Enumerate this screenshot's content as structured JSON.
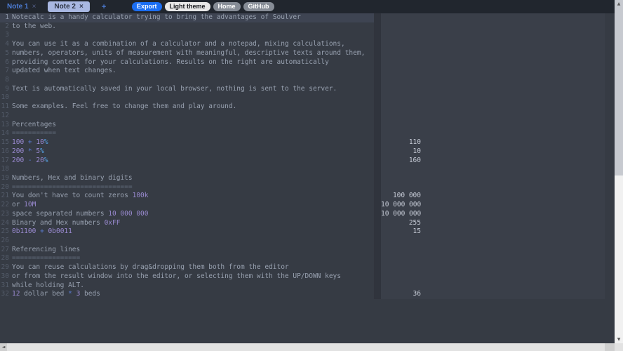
{
  "tabs": [
    {
      "label": "Note 1",
      "close": "×",
      "active": false
    },
    {
      "label": "Note 2",
      "close": "×",
      "active": true
    }
  ],
  "new_tab": "+",
  "toolbar": {
    "export": "Export",
    "light_theme": "Light theme",
    "home": "Home",
    "github": "GitHub"
  },
  "scrollbars": {
    "up": "▲",
    "down": "▼",
    "left": "◄"
  },
  "colors": {
    "topbar_bg": "#21262e",
    "editor_bg": "#363b44",
    "results_bg": "#3a3f49",
    "highlight_row_bg": "#3e4452",
    "accent_blue": "#1b6ef3",
    "tab_active_bg": "#a9b8e2",
    "text": "#98a1b0",
    "number": "#9b8bd2",
    "operator": "#5a7bd0",
    "percent": "#55a1e3",
    "result_text": "#c9ced9"
  },
  "editor": {
    "lines": [
      {
        "num": 1,
        "segments": [
          {
            "type": "t",
            "text": "Notecalc is a handy calculator trying to bring the advantages of Soulver"
          }
        ],
        "result": ""
      },
      {
        "num": 2,
        "segments": [
          {
            "type": "t",
            "text": "to the web."
          }
        ],
        "result": ""
      },
      {
        "num": 3,
        "segments": [],
        "result": ""
      },
      {
        "num": 4,
        "segments": [
          {
            "type": "t",
            "text": "You can use it as a combination of a calculator and a notepad, mixing calculations,"
          }
        ],
        "result": ""
      },
      {
        "num": 5,
        "segments": [
          {
            "type": "t",
            "text": "numbers, operators, units of measurement with meaningful, descriptive texts around them,"
          }
        ],
        "result": ""
      },
      {
        "num": 6,
        "segments": [
          {
            "type": "t",
            "text": "providing context for your calculations. Results on the right are automatically"
          }
        ],
        "result": ""
      },
      {
        "num": 7,
        "segments": [
          {
            "type": "t",
            "text": "updated when text changes."
          }
        ],
        "result": ""
      },
      {
        "num": 8,
        "segments": [],
        "result": ""
      },
      {
        "num": 9,
        "segments": [
          {
            "type": "t",
            "text": "Text is automatically saved in your local browser, nothing is sent to the server."
          }
        ],
        "result": ""
      },
      {
        "num": 10,
        "segments": [],
        "result": ""
      },
      {
        "num": 11,
        "segments": [
          {
            "type": "t",
            "text": "Some examples. Feel free to change them and play around."
          }
        ],
        "result": ""
      },
      {
        "num": 12,
        "segments": [],
        "result": ""
      },
      {
        "num": 13,
        "segments": [
          {
            "type": "t",
            "text": "Percentages"
          }
        ],
        "result": ""
      },
      {
        "num": 14,
        "segments": [
          {
            "type": "eq",
            "text": "==========="
          }
        ],
        "result": ""
      },
      {
        "num": 15,
        "segments": [
          {
            "type": "n",
            "text": "100"
          },
          {
            "type": "t",
            "text": " "
          },
          {
            "type": "o",
            "text": "+"
          },
          {
            "type": "t",
            "text": " "
          },
          {
            "type": "n",
            "text": "10"
          },
          {
            "type": "p",
            "text": "%"
          }
        ],
        "result": "110"
      },
      {
        "num": 16,
        "segments": [
          {
            "type": "n",
            "text": "200"
          },
          {
            "type": "t",
            "text": " "
          },
          {
            "type": "o",
            "text": "*"
          },
          {
            "type": "t",
            "text": " "
          },
          {
            "type": "n",
            "text": "5"
          },
          {
            "type": "p",
            "text": "%"
          }
        ],
        "result": "10"
      },
      {
        "num": 17,
        "segments": [
          {
            "type": "n",
            "text": "200"
          },
          {
            "type": "t",
            "text": " "
          },
          {
            "type": "o",
            "text": "-"
          },
          {
            "type": "t",
            "text": " "
          },
          {
            "type": "n",
            "text": "20"
          },
          {
            "type": "p",
            "text": "%"
          }
        ],
        "result": "160"
      },
      {
        "num": 18,
        "segments": [],
        "result": ""
      },
      {
        "num": 19,
        "segments": [
          {
            "type": "t",
            "text": "Numbers, Hex and binary digits"
          }
        ],
        "result": ""
      },
      {
        "num": 20,
        "segments": [
          {
            "type": "eq",
            "text": "=============================="
          }
        ],
        "result": ""
      },
      {
        "num": 21,
        "segments": [
          {
            "type": "t",
            "text": "You don't have to count zeros "
          },
          {
            "type": "n",
            "text": "100k"
          }
        ],
        "result": "100 000"
      },
      {
        "num": 22,
        "segments": [
          {
            "type": "t",
            "text": "or "
          },
          {
            "type": "n",
            "text": "10M"
          }
        ],
        "result": "10 000 000"
      },
      {
        "num": 23,
        "segments": [
          {
            "type": "t",
            "text": "space separated numbers "
          },
          {
            "type": "n",
            "text": "10 000 000"
          }
        ],
        "result": "10 000 000"
      },
      {
        "num": 24,
        "segments": [
          {
            "type": "t",
            "text": "Binary and Hex numbers "
          },
          {
            "type": "n",
            "text": "0xFF"
          }
        ],
        "result": "255"
      },
      {
        "num": 25,
        "segments": [
          {
            "type": "n",
            "text": "0b1100"
          },
          {
            "type": "t",
            "text": " "
          },
          {
            "type": "o",
            "text": "+"
          },
          {
            "type": "t",
            "text": " "
          },
          {
            "type": "n",
            "text": "0b0011"
          }
        ],
        "result": "15"
      },
      {
        "num": 26,
        "segments": [],
        "result": ""
      },
      {
        "num": 27,
        "segments": [
          {
            "type": "t",
            "text": "Referencing lines"
          }
        ],
        "result": ""
      },
      {
        "num": 28,
        "segments": [
          {
            "type": "eq",
            "text": "================="
          }
        ],
        "result": ""
      },
      {
        "num": 29,
        "segments": [
          {
            "type": "t",
            "text": "You can reuse calculations by drag&dropping them both from the editor"
          }
        ],
        "result": ""
      },
      {
        "num": 30,
        "segments": [
          {
            "type": "t",
            "text": "or from the result window into the editor, or selecting them with the UP/DOWN keys"
          }
        ],
        "result": ""
      },
      {
        "num": 31,
        "segments": [
          {
            "type": "t",
            "text": "while holding ALT."
          }
        ],
        "result": ""
      },
      {
        "num": 32,
        "segments": [
          {
            "type": "n",
            "text": "12"
          },
          {
            "type": "t",
            "text": " dollar bed "
          },
          {
            "type": "o",
            "text": "*"
          },
          {
            "type": "t",
            "text": " "
          },
          {
            "type": "n",
            "text": "3"
          },
          {
            "type": "t",
            "text": " beds"
          }
        ],
        "result": "36"
      }
    ]
  }
}
